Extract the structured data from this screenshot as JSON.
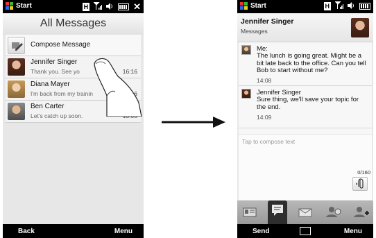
{
  "left_screen": {
    "status": {
      "start_label": "Start"
    },
    "title": "All Messages",
    "compose_label": "Compose Message",
    "threads": [
      {
        "name": "Jennifer Singer",
        "preview": "Thank you. See yo",
        "time": "16:16",
        "avatar": "jennifer"
      },
      {
        "name": "Diana Mayer",
        "preview": "I'm back from my trainin",
        "time": "16",
        "avatar": "diana"
      },
      {
        "name": "Ben Carter",
        "preview": "Let's catch up soon.",
        "time": "13:05",
        "avatar": "ben"
      }
    ],
    "softkeys": {
      "left": "Back",
      "right": "Menu"
    }
  },
  "right_screen": {
    "status": {
      "start_label": "Start"
    },
    "contact": {
      "name": "Jennifer Singer",
      "subtitle": "Messages"
    },
    "messages": [
      {
        "sender": "Me:",
        "text": "The lunch is going great. Might be a bit late back to the office. Can you tell Bob to start without  me?",
        "time": "14:08"
      },
      {
        "sender": "Jennifer Singer",
        "text": "Sure thing, we'll save your topic for the end.",
        "time": "14:09"
      }
    ],
    "compose": {
      "placeholder": "Tap to compose text",
      "char_count": "0/160"
    },
    "tabs": [
      "contact-card",
      "messages",
      "email",
      "contact-info",
      "add-contact"
    ],
    "softkeys": {
      "left": "Send",
      "right": "Menu"
    }
  },
  "colors": {
    "bar": "#000000",
    "screen_bg": "#e7e7e7",
    "arrow": "#111111"
  }
}
